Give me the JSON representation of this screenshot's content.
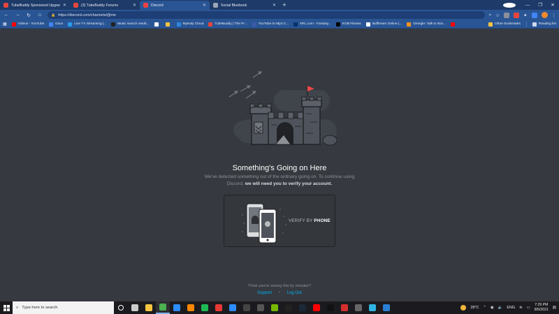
{
  "browser": {
    "tabs": [
      {
        "title": "TubeBuddy Sponsored Upgrades",
        "active": false,
        "color": "#e8453c"
      },
      {
        "title": "(3) TubeBuddy Forums",
        "active": false,
        "color": "#e8453c"
      },
      {
        "title": "Discord",
        "active": true,
        "color": "#ed4245"
      },
      {
        "title": "Social Bluebook",
        "active": false,
        "color": "#9aa6b8"
      }
    ],
    "new_tab_glyph": "+",
    "address": "https://discord.com/channels/@me",
    "bookmarks": [
      {
        "label": "Videos - YouTube",
        "color": "#ff0000"
      },
      {
        "label": "Docs",
        "color": "#4285f4"
      },
      {
        "label": "Live TV Streaming |...",
        "color": "#2b9be8"
      },
      {
        "label": "Music search result...",
        "color": "#222222"
      },
      {
        "label": "",
        "color": "#ffffff"
      },
      {
        "label": "",
        "color": "#f5c542"
      },
      {
        "label": "MyKaty Cloud",
        "color": "#2e86de"
      },
      {
        "label": "TubeBuddy | The Pr...",
        "color": "#e8453c"
      },
      {
        "label": "YouTube to Mp3 C...",
        "color": "#3b5ba8"
      },
      {
        "label": "NFL.com - Fantasy...",
        "color": "#013369"
      },
      {
        "label": "KOB Fitness",
        "color": "#000000"
      },
      {
        "label": "Bufftream Online |...",
        "color": "#ffffff"
      },
      {
        "label": "Omegle: Talk to stra...",
        "color": "#f7931e"
      },
      {
        "label": "",
        "color": "#ff0000"
      }
    ],
    "other_bookmarks": "Other bookmarks",
    "reading_list": "Reading list"
  },
  "main": {
    "heading": "Something's Going on Here",
    "description_plain": "We've detected something out of the ordinary going on. To continue using Discord,",
    "description_bold": "we will need you to verify your account.",
    "verify_prefix": "VERIFY BY",
    "verify_method": "PHONE",
    "mistake_text": "Think you're seeing this by mistake?",
    "support_link": "Support",
    "separator": "•",
    "logout_link": "Log Out"
  },
  "taskbar": {
    "search_placeholder": "Type here to search",
    "apps": [
      {
        "name": "cortana",
        "color": "#ffffff",
        "active": false
      },
      {
        "name": "task-view",
        "color": "#cccccc",
        "active": false
      },
      {
        "name": "file-explorer",
        "color": "#f5c542",
        "active": false
      },
      {
        "name": "chrome",
        "color": "#4caf50",
        "active": true
      },
      {
        "name": "zoom",
        "color": "#2d8cff",
        "active": false
      },
      {
        "name": "vlc",
        "color": "#ff8800",
        "active": false
      },
      {
        "name": "spotify",
        "color": "#1db954",
        "active": false
      },
      {
        "name": "record",
        "color": "#e53935",
        "active": false
      },
      {
        "name": "zoom-2",
        "color": "#2d8cff",
        "active": false
      },
      {
        "name": "media",
        "color": "#444444",
        "active": false
      },
      {
        "name": "app-dark",
        "color": "#555555",
        "active": false
      },
      {
        "name": "nvidia",
        "color": "#76b900",
        "active": false
      },
      {
        "name": "app-text",
        "color": "#222222",
        "active": false
      },
      {
        "name": "steam",
        "color": "#1b2838",
        "active": false
      },
      {
        "name": "youtube",
        "color": "#ff0000",
        "active": false
      },
      {
        "name": "tiktok",
        "color": "#111111",
        "active": false
      },
      {
        "name": "app-red",
        "color": "#d62f2f",
        "active": false
      },
      {
        "name": "app-gray",
        "color": "#666666",
        "active": false
      },
      {
        "name": "edge",
        "color": "#2fb3e0",
        "active": false
      },
      {
        "name": "photos",
        "color": "#2a7fd4",
        "active": false
      }
    ],
    "temperature": "28°C",
    "language": "ENG",
    "time": "7:29 PM",
    "date": "8/5/2021"
  },
  "colors": {
    "background": "#36393f",
    "link": "#00b0f4",
    "chrome_frame": "#2a5594"
  }
}
